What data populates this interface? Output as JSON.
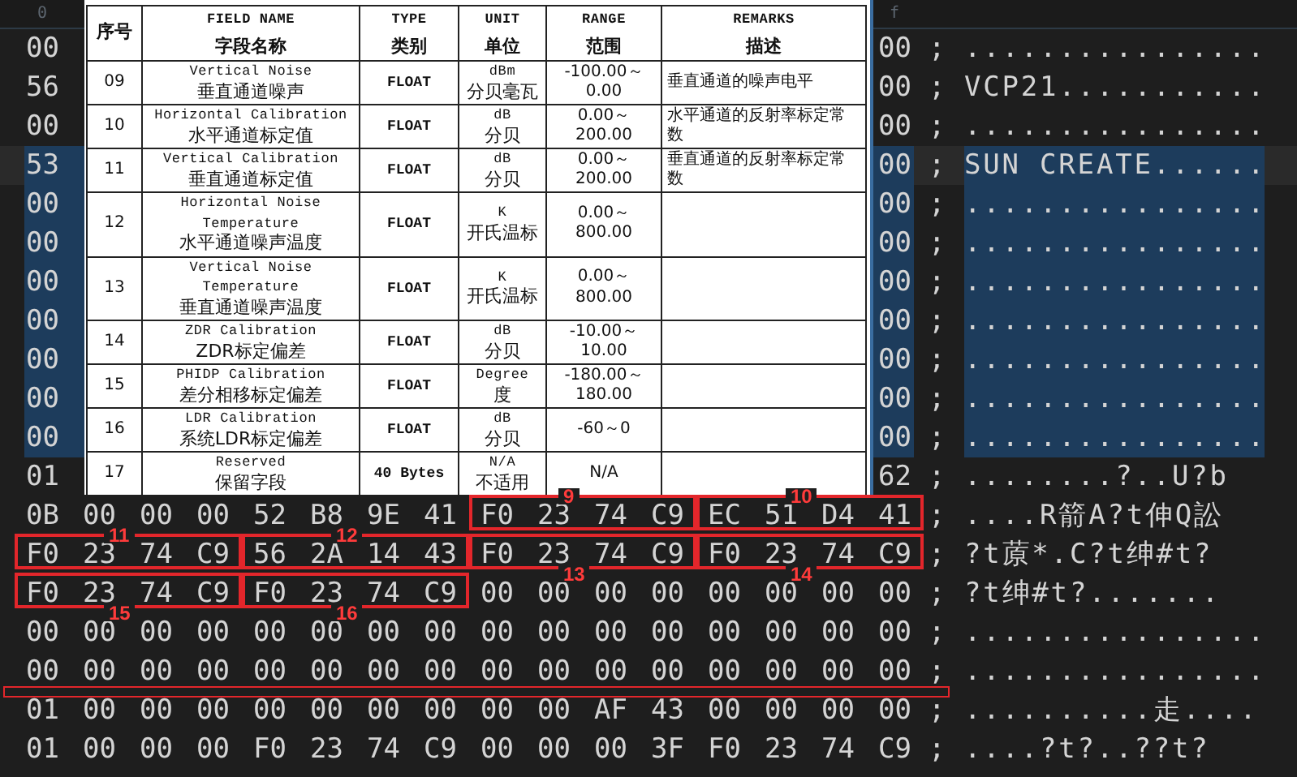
{
  "editor": {
    "column_labels": [
      "0",
      "f"
    ],
    "rows": [
      {
        "first_byte": "00",
        "last_byte": "00",
        "separator": ";",
        "ascii": "................",
        "selected": false,
        "current": false
      },
      {
        "first_byte": "56",
        "last_byte": "00",
        "separator": ";",
        "ascii": "VCP21...........",
        "selected": false,
        "current": false
      },
      {
        "first_byte": "00",
        "last_byte": "00",
        "separator": ";",
        "ascii": "................",
        "selected": false,
        "current": false
      },
      {
        "first_byte": "53",
        "last_byte": "00",
        "separator": ";",
        "ascii": "SUN CREATE......",
        "selected": true,
        "current": true
      },
      {
        "first_byte": "00",
        "last_byte": "00",
        "separator": ";",
        "ascii": "................",
        "selected": true,
        "current": false
      },
      {
        "first_byte": "00",
        "last_byte": "00",
        "separator": ";",
        "ascii": "................",
        "selected": true,
        "current": false
      },
      {
        "first_byte": "00",
        "last_byte": "00",
        "separator": ";",
        "ascii": "................",
        "selected": true,
        "current": false
      },
      {
        "first_byte": "00",
        "last_byte": "00",
        "separator": ";",
        "ascii": "................",
        "selected": true,
        "current": false
      },
      {
        "first_byte": "00",
        "last_byte": "00",
        "separator": ";",
        "ascii": "................",
        "selected": true,
        "current": false
      },
      {
        "first_byte": "00",
        "last_byte": "00",
        "separator": ";",
        "ascii": "................",
        "selected": true,
        "current": false
      },
      {
        "first_byte": "00",
        "last_byte": "00",
        "separator": ";",
        "ascii": "................",
        "selected": true,
        "current": false
      },
      {
        "first_byte": "01",
        "last_byte": "62",
        "separator": ";",
        "ascii": "........?..U?b",
        "selected": false,
        "current": false
      },
      {
        "groups": [
          {
            "bytes": [
              "0B",
              "00",
              "00",
              "00"
            ]
          },
          {
            "bytes": [
              "52",
              "B8",
              "9E",
              "41"
            ]
          },
          {
            "bytes": [
              "F0",
              "23",
              "74",
              "C9"
            ],
            "annotation": {
              "label": "9",
              "kind": "above"
            }
          },
          {
            "bytes": [
              "EC",
              "51",
              "D4",
              "41"
            ],
            "annotation": {
              "label": "10",
              "kind": "above"
            }
          }
        ],
        "separator": ";",
        "ascii": "....R箭A?t伸Q訟",
        "selected": false,
        "current": false
      },
      {
        "groups": [
          {
            "bytes": [
              "F0",
              "23",
              "74",
              "C9"
            ],
            "annotation": {
              "label": "11",
              "kind": "above"
            }
          },
          {
            "bytes": [
              "56",
              "2A",
              "14",
              "43"
            ],
            "annotation": {
              "label": "12",
              "kind": "above"
            }
          },
          {
            "bytes": [
              "F0",
              "23",
              "74",
              "C9"
            ],
            "annotation": {
              "label": "13",
              "kind": "below"
            }
          },
          {
            "bytes": [
              "F0",
              "23",
              "74",
              "C9"
            ],
            "annotation": {
              "label": "14",
              "kind": "below"
            }
          }
        ],
        "separator": ";",
        "ascii": "?t蒝*.C?t绅#t?",
        "selected": false,
        "current": false
      },
      {
        "groups": [
          {
            "bytes": [
              "F0",
              "23",
              "74",
              "C9"
            ],
            "annotation": {
              "label": "15",
              "kind": "below"
            }
          },
          {
            "bytes": [
              "F0",
              "23",
              "74",
              "C9"
            ],
            "annotation": {
              "label": "16",
              "kind": "below"
            }
          },
          {
            "bytes": [
              "00",
              "00",
              "00",
              "00"
            ]
          },
          {
            "bytes": [
              "00",
              "00",
              "00",
              "00"
            ]
          }
        ],
        "separator": ";",
        "ascii": "?t绅#t?.......",
        "selected": false,
        "current": false
      },
      {
        "groups": [
          {
            "bytes": [
              "00",
              "00",
              "00",
              "00"
            ]
          },
          {
            "bytes": [
              "00",
              "00",
              "00",
              "00"
            ]
          },
          {
            "bytes": [
              "00",
              "00",
              "00",
              "00"
            ]
          },
          {
            "bytes": [
              "00",
              "00",
              "00",
              "00"
            ]
          }
        ],
        "separator": ";",
        "ascii": "................",
        "selected": false,
        "current": false
      },
      {
        "groups": [
          {
            "bytes": [
              "00",
              "00",
              "00",
              "00"
            ]
          },
          {
            "bytes": [
              "00",
              "00",
              "00",
              "00"
            ]
          },
          {
            "bytes": [
              "00",
              "00",
              "00",
              "00"
            ]
          },
          {
            "bytes": [
              "00",
              "00",
              "00",
              "00"
            ]
          }
        ],
        "separator": ";",
        "ascii": "................",
        "selected": false,
        "current": false,
        "marked_below": true
      },
      {
        "groups": [
          {
            "bytes": [
              "01",
              "00",
              "00",
              "00"
            ]
          },
          {
            "bytes": [
              "00",
              "00",
              "00",
              "00"
            ]
          },
          {
            "bytes": [
              "00",
              "00",
              "AF",
              "43"
            ]
          },
          {
            "bytes": [
              "00",
              "00",
              "00",
              "00"
            ]
          }
        ],
        "separator": ";",
        "ascii": "..........走....",
        "selected": false,
        "current": false
      },
      {
        "groups": [
          {
            "bytes": [
              "01",
              "00",
              "00",
              "00"
            ]
          },
          {
            "bytes": [
              "F0",
              "23",
              "74",
              "C9"
            ]
          },
          {
            "bytes": [
              "00",
              "00",
              "00",
              "3F"
            ]
          },
          {
            "bytes": [
              "F0",
              "23",
              "74",
              "C9"
            ]
          }
        ],
        "separator": ";",
        "ascii": "....?t?..??t?",
        "selected": false,
        "current": false
      }
    ]
  },
  "document_table": {
    "columns": [
      {
        "zh": "序号"
      },
      {
        "en": "FIELD NAME",
        "zh": "字段名称"
      },
      {
        "en": "TYPE",
        "zh": "类别"
      },
      {
        "en": "UNIT",
        "zh": "单位"
      },
      {
        "en": "RANGE",
        "zh": "范围"
      },
      {
        "en": "REMARKS",
        "zh": "描述"
      }
    ],
    "rows": [
      {
        "no": "09",
        "field": {
          "en": "Vertical Noise",
          "zh": "垂直通道噪声"
        },
        "type": "FLOAT",
        "unit": {
          "en": "dBm",
          "zh": "分贝毫瓦"
        },
        "range": [
          "-100.00～",
          "0.00"
        ],
        "remarks": "垂直通道的噪声电平"
      },
      {
        "no": "10",
        "field": {
          "en": "Horizontal Calibration",
          "zh": "水平通道标定值"
        },
        "type": "FLOAT",
        "unit": {
          "en": "dB",
          "zh": "分贝"
        },
        "range": [
          "0.00～",
          "200.00"
        ],
        "remarks": "水平通道的反射率标定常数"
      },
      {
        "no": "11",
        "field": {
          "en": "Vertical Calibration",
          "zh": "垂直通道标定值"
        },
        "type": "FLOAT",
        "unit": {
          "en": "dB",
          "zh": "分贝"
        },
        "range": [
          "0.00～",
          "200.00"
        ],
        "remarks": "垂直通道的反射率标定常数"
      },
      {
        "no": "12",
        "field": {
          "en": "Horizontal Noise Temperature",
          "zh": "水平通道噪声温度"
        },
        "type": "FLOAT",
        "unit": {
          "en": "K",
          "zh": "开氏温标"
        },
        "range": [
          "0.00～",
          "800.00"
        ]
      },
      {
        "no": "13",
        "field": {
          "en": "Vertical Noise Temperature",
          "zh": "垂直通道噪声温度"
        },
        "type": "FLOAT",
        "unit": {
          "en": "K",
          "zh": "开氏温标"
        },
        "range": [
          "0.00～",
          "800.00"
        ]
      },
      {
        "no": "14",
        "field": {
          "en": "ZDR Calibration",
          "zh": "ZDR标定偏差"
        },
        "type": "FLOAT",
        "unit": {
          "en": "dB",
          "zh": "分贝"
        },
        "range": [
          "-10.00～",
          "10.00"
        ]
      },
      {
        "no": "15",
        "field": {
          "en": "PHIDP Calibration",
          "zh": "差分相移标定偏差"
        },
        "type": "FLOAT",
        "unit": {
          "en": "Degree",
          "zh": "度"
        },
        "range": [
          "-180.00～",
          "180.00"
        ]
      },
      {
        "no": "16",
        "field": {
          "en": "LDR Calibration",
          "zh": "系统LDR标定偏差"
        },
        "type": "FLOAT",
        "unit": {
          "en": "dB",
          "zh": "分贝"
        },
        "range": [
          "-60～0"
        ]
      },
      {
        "no": "17",
        "field": {
          "en": "Reserved",
          "zh": "保留字段"
        },
        "type": "40 Bytes",
        "unit": {
          "en": "N/A",
          "zh": "不适用"
        },
        "range": [
          "N/A"
        ]
      }
    ]
  }
}
